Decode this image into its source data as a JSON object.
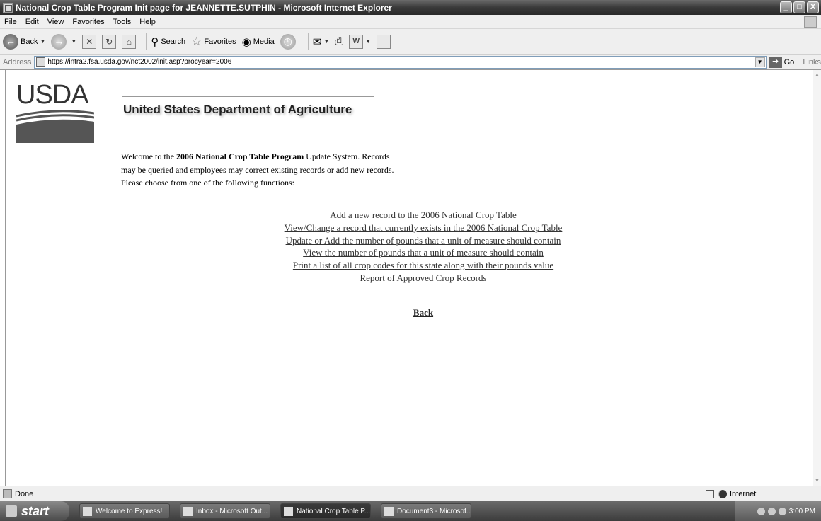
{
  "window": {
    "title": "National Crop Table Program Init page for JEANNETTE.SUTPHIN - Microsoft Internet Explorer",
    "controls": {
      "minimize": "_",
      "maximize": "□",
      "close": "X"
    }
  },
  "menu": [
    "File",
    "Edit",
    "View",
    "Favorites",
    "Tools",
    "Help"
  ],
  "toolbar": {
    "back": "Back",
    "search": "Search",
    "favorites": "Favorites",
    "media": "Media"
  },
  "address": {
    "label": "Address",
    "url": "https://intra2.fsa.usda.gov/nct2002/init.asp?procyear=2006",
    "go": "Go",
    "links": "Links"
  },
  "page": {
    "logo_text": "USDA",
    "department": "United States Department of Agriculture",
    "welcome": {
      "pre": "Welcome to the ",
      "bold": "2006 National Crop Table Program",
      "post": " Update System. Records",
      "line2": "may be queried and employees may correct existing records or add new records.",
      "line3": "Please choose from one of the following functions:"
    },
    "functions": [
      "Add a new record to the 2006 National Crop Table",
      "View/Change a record that currently exists in the 2006 National Crop Table",
      "Update or Add the number of pounds that a unit of measure should contain",
      "View the number of pounds that a unit of measure should contain",
      "Print a list of all crop codes for this state along with their pounds value",
      "Report of Approved Crop Records"
    ],
    "back": "Back"
  },
  "status": {
    "text": "Done",
    "zone": "Internet"
  },
  "taskbar": {
    "start": "start",
    "tasks": [
      "Welcome to Express!",
      "Inbox - Microsoft Out...",
      "National Crop Table P...",
      "Document3 - Microsof..."
    ],
    "clock": "3:00 PM"
  }
}
